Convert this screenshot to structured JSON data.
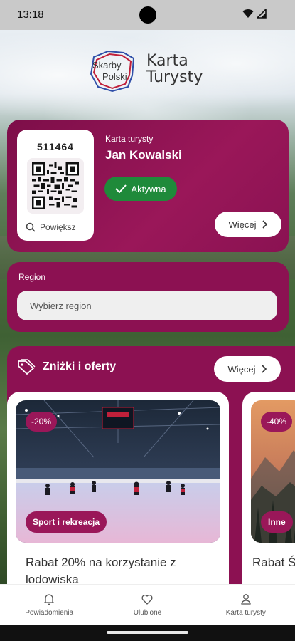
{
  "status_bar": {
    "time": "13:18"
  },
  "logo": {
    "badge_line1": "Skarby",
    "badge_line2": "Polski",
    "title": "Karta Turysty",
    "title_line1": "Karta",
    "title_line2": "Turysty"
  },
  "tourist_card": {
    "number": "511464",
    "zoom_label": "Powiększ",
    "label": "Karta turysty",
    "name": "Jan Kowalski",
    "status": "Aktywna",
    "status_color": "#1f8a3a",
    "more_label": "Więcej"
  },
  "region": {
    "label": "Region",
    "placeholder": "Wybierz region"
  },
  "offers": {
    "title": "Zniżki i oferty",
    "more_label": "Więcej",
    "items": [
      {
        "discount": "-20%",
        "category": "Sport i rekreacja",
        "title": "Rabat 20% na korzystanie z lodowiska"
      },
      {
        "discount": "-40%",
        "category": "Inne",
        "title": "Rabat Śląski"
      }
    ]
  },
  "bottom_nav": {
    "items": [
      {
        "label": "Powiadomienia",
        "icon": "bell-icon"
      },
      {
        "label": "Ulubione",
        "icon": "heart-icon"
      },
      {
        "label": "Karta turysty",
        "icon": "user-icon"
      }
    ]
  },
  "colors": {
    "brand": "#8c1152",
    "accent": "#9a1759",
    "success": "#1f8a3a"
  }
}
